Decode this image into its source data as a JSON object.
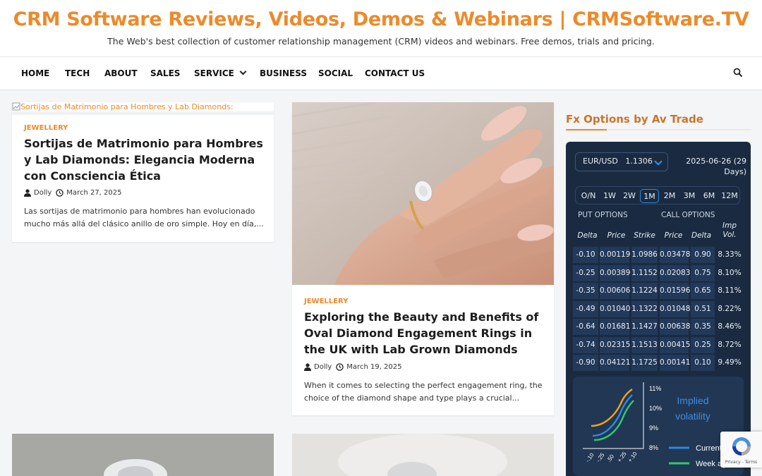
{
  "header": {
    "title": "CRM Software Reviews, Videos, Demos & Webinars | CRMSoftware.TV",
    "tagline": "The Web's best collection of customer relationship management (CRM) videos and webinars. Free demos, trials and pricing."
  },
  "nav": {
    "items": [
      "HOME",
      "TECH",
      "ABOUT",
      "SALES",
      "SERVICE",
      "BUSINESS",
      "SOCIAL",
      "CONTACT US"
    ],
    "search_icon": "search-icon"
  },
  "posts": [
    {
      "broken_image_alt": "Sortijas de Matrimonio para Hombres y Lab Diamonds:",
      "category": "JEWELLERY",
      "title": "Sortijas de Matrimonio para Hombres y Lab Diamonds: Elegancia Moderna con Consciencia Ética",
      "author": "Dolly",
      "date": "March 27, 2025",
      "excerpt": "Las sortijas de matrimonio para hombres han evolucionado mucho más allá del clásico anillo de oro simple. Hoy en día,..."
    },
    {
      "category": "JEWELLERY",
      "title": "Exploring the Beauty and Benefits of Oval Diamond Engagement Rings in the UK with Lab Grown Diamonds",
      "author": "Dolly",
      "date": "March 19, 2025",
      "excerpt": "When it comes to selecting the perfect engagement ring, the choice of the diamond shape and type plays a crucial..."
    }
  ],
  "widget": {
    "title": "Fx Options by Av Trade",
    "pair": "EUR/USD",
    "spot": "1.1306",
    "expiry": "2025-06-26 (29 Days)",
    "tenors": [
      "O/N",
      "1W",
      "2W",
      "1M",
      "2M",
      "3M",
      "6M",
      "12M"
    ],
    "active_tenor": "1M",
    "put_label": "PUT OPTIONS",
    "call_label": "CALL OPTIONS",
    "columns": [
      "Delta",
      "Price",
      "Strike",
      "Price",
      "Delta",
      "Imp Vol."
    ],
    "rows": [
      [
        "-0.10",
        "0.00119",
        "1.0986",
        "0.03478",
        "0.90",
        "8.33%"
      ],
      [
        "-0.25",
        "0.00389",
        "1.1152",
        "0.02083",
        "0.75",
        "8.10%"
      ],
      [
        "-0.35",
        "0.00606",
        "1.1224",
        "0.01596",
        "0.65",
        "8.11%"
      ],
      [
        "-0.49",
        "0.01040",
        "1.1322",
        "0.01048",
        "0.51",
        "8.22%"
      ],
      [
        "-0.64",
        "0.01681",
        "1.1427",
        "0.00638",
        "0.35",
        "8.46%"
      ],
      [
        "-0.74",
        "0.02315",
        "1.1513",
        "0.00415",
        "0.25",
        "8.72%"
      ],
      [
        "-0.90",
        "0.04121",
        "1.1725",
        "0.00141",
        "0.10",
        "9.49%"
      ]
    ],
    "chart": {
      "title": "Implied volatility",
      "y_ticks": [
        "11%",
        "10%",
        "9%",
        "8%"
      ],
      "x_ticks": [
        "-.10",
        "-.25",
        ".50",
        "+.25",
        "+.10"
      ],
      "legend": [
        "Current",
        "Week ago"
      ],
      "colors": {
        "current": "#f0a020",
        "week_ago": "#2fc96a",
        "blue": "#2f86e0"
      }
    }
  },
  "recaptcha": {
    "links": "Privacy - Terms"
  }
}
